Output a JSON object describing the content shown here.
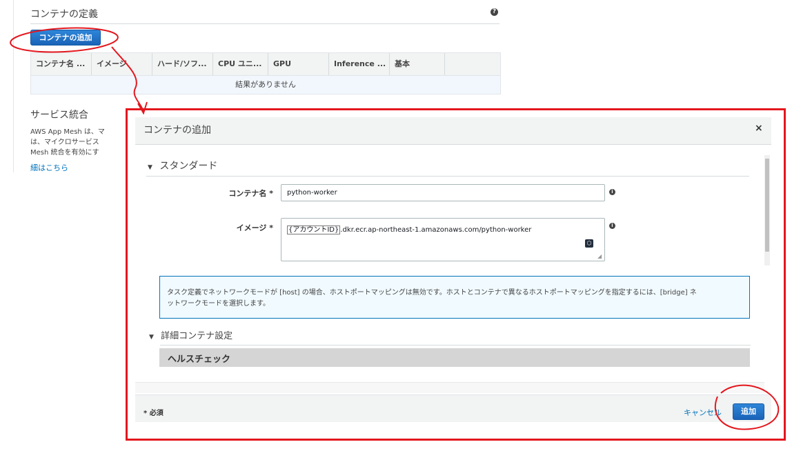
{
  "container_definitions": {
    "title": "コンテナの定義",
    "help_icon_glyph": "?",
    "add_button_label": "コンテナの追加",
    "columns": [
      "コンテナ名 ...",
      "イメージ",
      "ハード/ソフ...",
      "CPU ユニ...",
      "GPU",
      "Inference ...",
      "基本",
      ""
    ],
    "empty_message": "結果がありません"
  },
  "service_integration": {
    "title": "サービス統合",
    "lines": [
      "AWS App Mesh は、マ",
      "は、マイクロサービス",
      "Mesh 統合を有効にす"
    ],
    "link": "細はこちら"
  },
  "modal": {
    "title": "コンテナの追加",
    "close_glyph": "×",
    "standard_section": "スタンダード",
    "container_name_label": "コンテナ名 *",
    "container_name_value": "python-worker",
    "image_label": "イメージ *",
    "image_value_highlight": "{アカウントID}",
    "image_value_rest": ".dkr.ecr.ap-northeast-1.amazonaws.com/python-worker",
    "info_text_cut": "タスク定義でネットワークモードが [host] の場合、ホストポートマッピングは無効です。ホストとコンテナで異なるホストポートマッピングを指定するには、[bridge] ネ",
    "info_text": "ットワークモードを選択します。",
    "advanced_section": "詳細コンテナ設定",
    "health_check": "ヘルスチェック",
    "required_note": "* 必須",
    "cancel_label": "キャンセル",
    "add_label": "追加"
  },
  "annotation_colors": {
    "frame": "#e3171e",
    "accent_button": "#1a63b8"
  }
}
